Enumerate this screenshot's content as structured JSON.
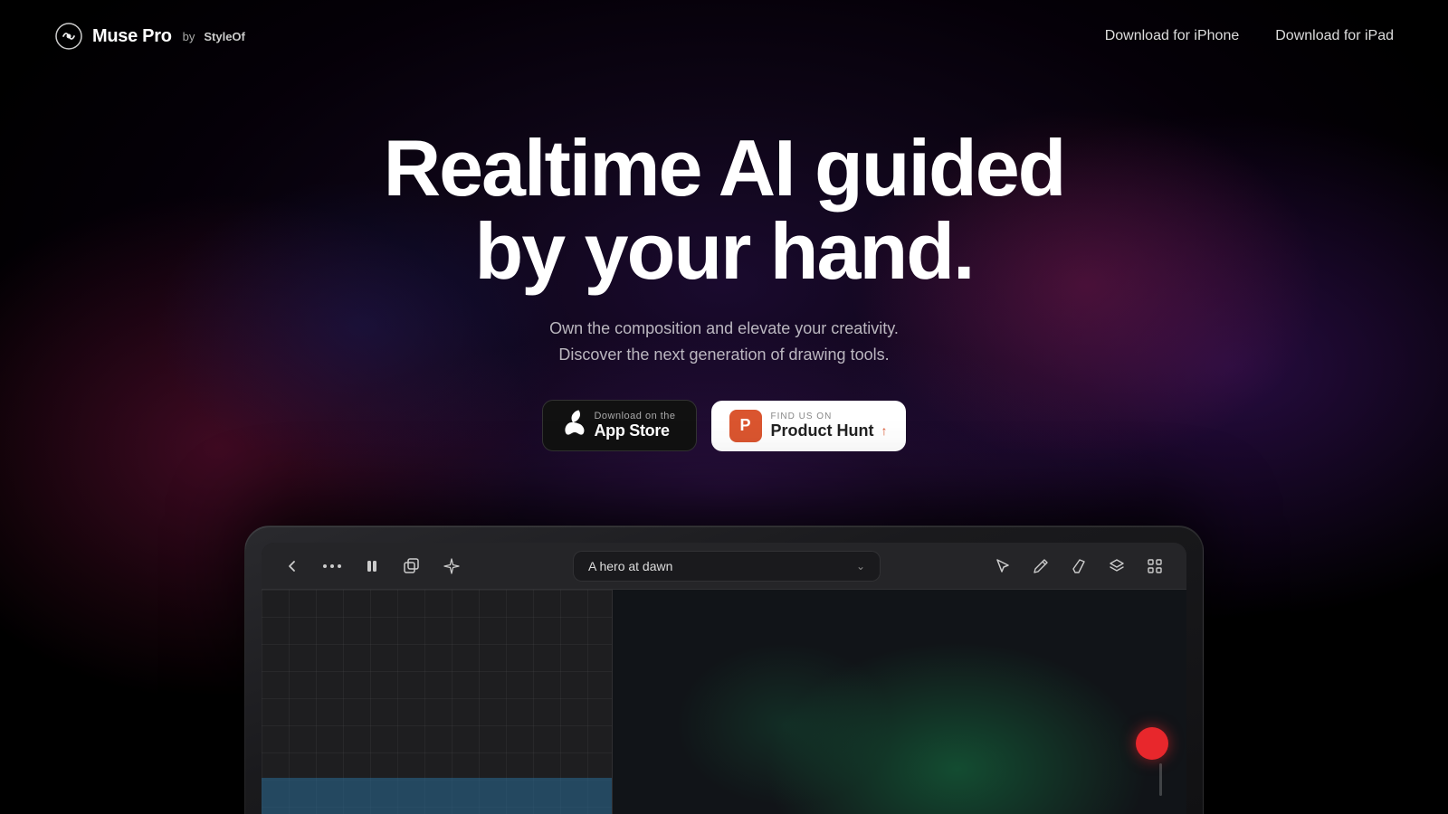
{
  "page": {
    "title": "Muse Pro by StyleOf"
  },
  "navbar": {
    "logo": {
      "name": "Muse Pro",
      "by_text": "by",
      "company": "StyleOf"
    },
    "links": [
      {
        "label": "Download for iPhone",
        "id": "download-iphone"
      },
      {
        "label": "Download for iPad",
        "id": "download-ipad"
      }
    ]
  },
  "hero": {
    "title_line1": "Realtime AI guided",
    "title_line2": "by your hand.",
    "subtitle_line1": "Own the composition and elevate your creativity.",
    "subtitle_line2": "Discover the next generation of drawing tools.",
    "cta": {
      "appstore": {
        "small_text": "Download on the",
        "label": "App Store"
      },
      "producthunt": {
        "small_text": "FIND US ON",
        "label": "Product Hunt",
        "arrow": "↑"
      }
    }
  },
  "device": {
    "app": {
      "toolbar": {
        "prompt_text": "A hero at dawn",
        "prompt_chevron": "⌄"
      }
    }
  },
  "icons": {
    "apple": "🍎",
    "back_arrow": "←",
    "dots": "···",
    "pause": "⏸",
    "layers_copy": "⧉",
    "sparkle": "✦",
    "cursor": "↖",
    "pen": "✒",
    "eraser": "⌫",
    "layers": "◫",
    "expand": "⊞"
  }
}
